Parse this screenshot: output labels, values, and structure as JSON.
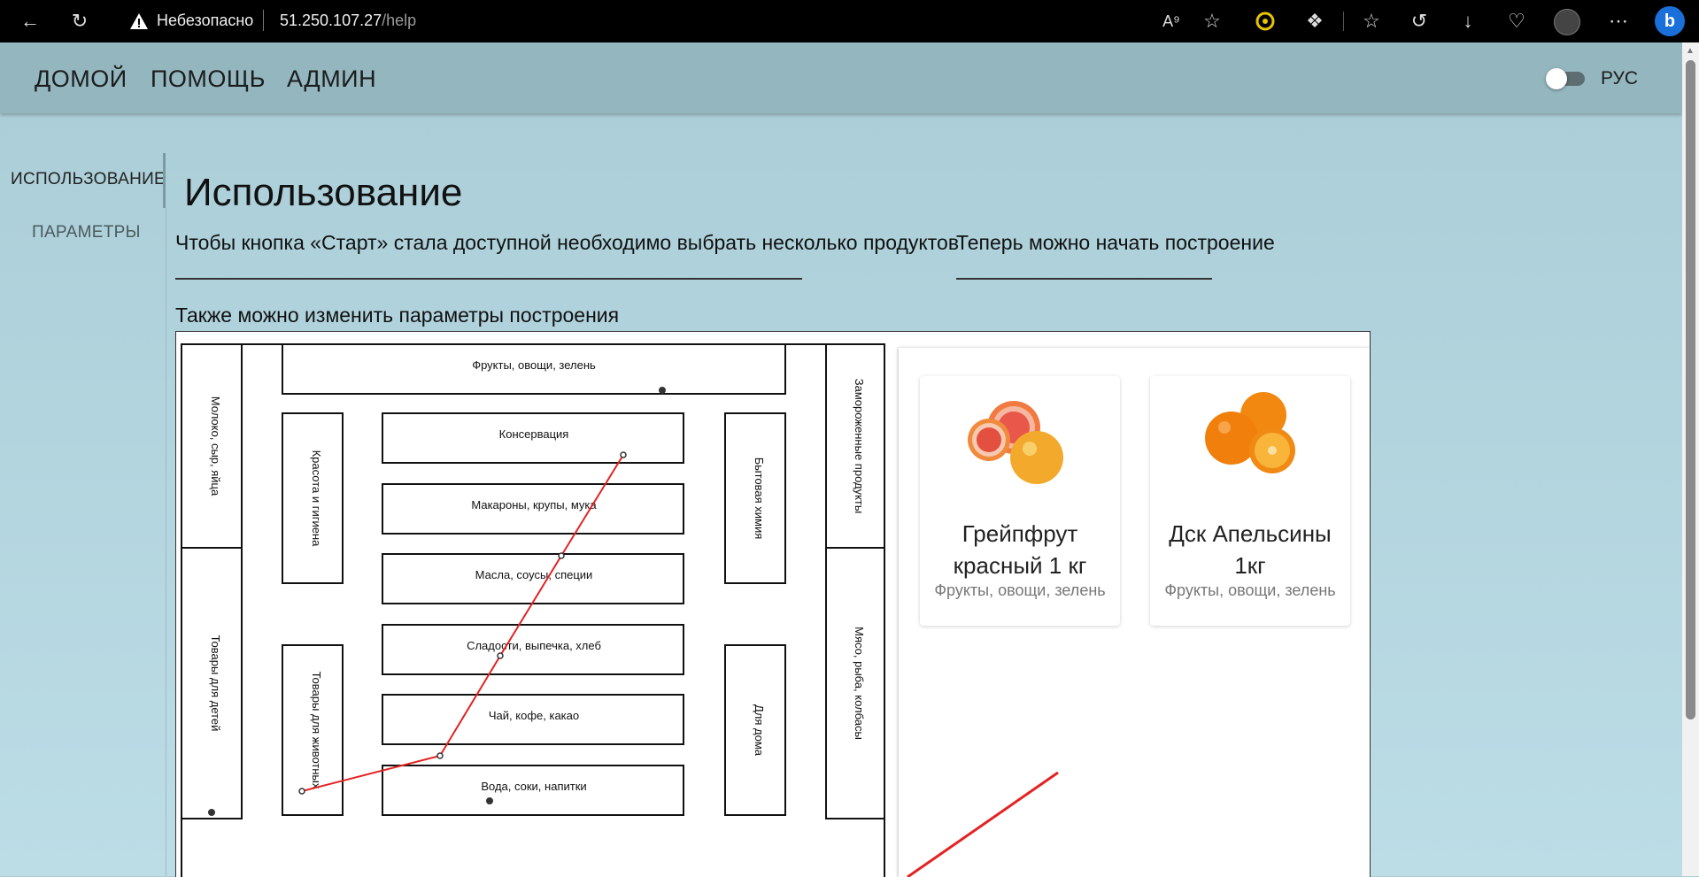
{
  "browser": {
    "security_label": "Небезопасно",
    "url_host": "51.250.107.27",
    "url_path": "/help"
  },
  "nav": {
    "links": [
      "ДОМОЙ",
      "ПОМОЩЬ",
      "АДМИН"
    ],
    "language": "РУС"
  },
  "sidebar": {
    "items": [
      "ИСПОЛЬЗОВАНИЕ",
      "ПАРАМЕТРЫ"
    ]
  },
  "content": {
    "title": "Использование",
    "hint_1": "Чтобы кнопка «Старт» стала доступной необходимо выбрать несколько продуктов",
    "hint_2": "Теперь можно начать построение",
    "hint_3": "Также можно изменить параметры построения"
  },
  "store_map": {
    "sections": [
      "Фрукты, овощи, зелень",
      "Консервация",
      "Макароны, крупы, мука",
      "Масла, соусы, специи",
      "Сладости, выпечка, хлеб",
      "Чай, кофе, какао",
      "Вода, соки, напитки",
      "Молоко, сыр, яйца",
      "Товары для детей",
      "Красота и гигиена",
      "Товары для животных",
      "Бытовая химия",
      "Для дома",
      "Замороженные продукты",
      "Мясо, рыба, колбасы"
    ],
    "route_color": "#e32222"
  },
  "products": [
    {
      "name": "Грейпфрут красный 1 кг",
      "category": "Фрукты, овощи, зелень"
    },
    {
      "name": "Дск Апельсины 1кг",
      "category": "Фрукты, овощи, зелень"
    }
  ]
}
